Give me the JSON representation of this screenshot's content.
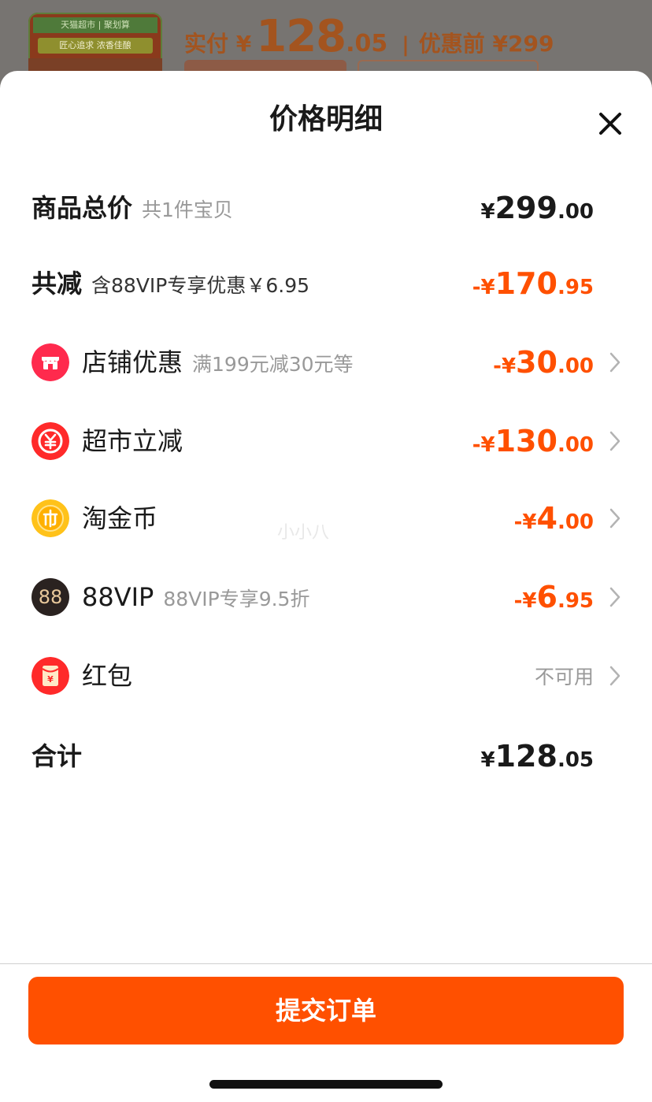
{
  "background": {
    "thumb_line1": "天猫超市 | 聚划算",
    "thumb_line2": "匠心追求 浓香佳酿",
    "paid_label": "实付 ¥",
    "paid_int": "128",
    "paid_dec": ".05",
    "separator": "|",
    "original_label": "优惠前 ¥299"
  },
  "sheet": {
    "title": "价格明细",
    "rows": [
      {
        "label": "商品总价",
        "sub": "共1件宝贝",
        "amount_sym": "¥",
        "amount_int": "299",
        "amount_dec": ".00"
      },
      {
        "label": "共减",
        "sub": "含88VIP专享优惠￥6.95",
        "amount_sym": "-¥",
        "amount_int": "170",
        "amount_dec": ".95"
      },
      {
        "label": "店铺优惠",
        "sub": "满199元减30元等",
        "icon": "store-icon",
        "amount_sym": "-¥",
        "amount_int": "30",
        "amount_dec": ".00"
      },
      {
        "label": "超市立减",
        "sub": "",
        "icon": "yuan-coin-icon",
        "amount_sym": "-¥",
        "amount_int": "130",
        "amount_dec": ".00"
      },
      {
        "label": "淘金币",
        "sub": "",
        "icon": "gold-coin-icon",
        "amount_sym": "-¥",
        "amount_int": "4",
        "amount_dec": ".00"
      },
      {
        "label": "88VIP",
        "sub": "88VIP专享9.5折",
        "icon": "vip88-icon",
        "icon_text": "88",
        "amount_sym": "-¥",
        "amount_int": "6",
        "amount_dec": ".95"
      },
      {
        "label": "红包",
        "sub": "",
        "icon": "red-envelope-icon",
        "icon_text": "¥",
        "note": "不可用"
      },
      {
        "label": "合计",
        "sub": "",
        "amount_sym": "¥",
        "amount_int": "128",
        "amount_dec": ".05"
      }
    ],
    "watermark": "小小八",
    "submit_label": "提交订单"
  },
  "colors": {
    "accent": "#ff5000",
    "text": "#1a1a1a",
    "muted": "#999999"
  }
}
